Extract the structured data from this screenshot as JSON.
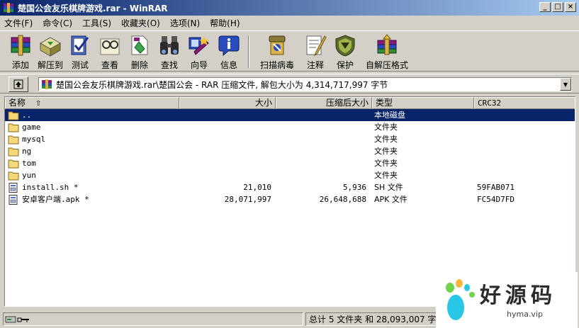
{
  "window": {
    "title": "楚国公会友乐棋牌游戏.rar - WinRAR",
    "controls": [
      "_",
      "□",
      "×"
    ]
  },
  "menu": [
    "文件(F)",
    "命令(C)",
    "工具(S)",
    "收藏夹(O)",
    "选项(N)",
    "帮助(H)"
  ],
  "toolbar": [
    {
      "label": "添加",
      "icon": "add-archive-icon"
    },
    {
      "label": "解压到",
      "icon": "extract-to-icon"
    },
    {
      "label": "测试",
      "icon": "test-icon"
    },
    {
      "label": "查看",
      "icon": "view-icon"
    },
    {
      "label": "删除",
      "icon": "delete-icon"
    },
    {
      "label": "查找",
      "icon": "find-icon"
    },
    {
      "label": "向导",
      "icon": "wizard-icon"
    },
    {
      "label": "信息",
      "icon": "info-icon"
    },
    {
      "label": "扫描病毒",
      "icon": "virus-scan-icon"
    },
    {
      "label": "注释",
      "icon": "comment-icon"
    },
    {
      "label": "保护",
      "icon": "protect-icon"
    },
    {
      "label": "自解压格式",
      "icon": "sfx-icon"
    }
  ],
  "address": {
    "path": "楚国公会友乐棋牌游戏.rar\\楚国公会 - RAR 压缩文件, 解包大小为 4,314,717,997 字节"
  },
  "columns": {
    "name": "名称",
    "size": "大小",
    "packed": "压缩后大小",
    "type": "类型",
    "crc": "CRC32"
  },
  "files": [
    {
      "name": "..",
      "size": "",
      "packed": "",
      "type": "本地磁盘",
      "crc": "",
      "kind": "folder-up",
      "selected": true
    },
    {
      "name": "game",
      "size": "",
      "packed": "",
      "type": "文件夹",
      "crc": "",
      "kind": "folder"
    },
    {
      "name": "mysql",
      "size": "",
      "packed": "",
      "type": "文件夹",
      "crc": "",
      "kind": "folder"
    },
    {
      "name": "ng",
      "size": "",
      "packed": "",
      "type": "文件夹",
      "crc": "",
      "kind": "folder"
    },
    {
      "name": "tom",
      "size": "",
      "packed": "",
      "type": "文件夹",
      "crc": "",
      "kind": "folder"
    },
    {
      "name": "yun",
      "size": "",
      "packed": "",
      "type": "文件夹",
      "crc": "",
      "kind": "folder"
    },
    {
      "name": "install.sh *",
      "size": "21,010",
      "packed": "5,936",
      "type": "SH 文件",
      "crc": "59FAB071",
      "kind": "file"
    },
    {
      "name": "安卓客户端.apk *",
      "size": "28,071,997",
      "packed": "26,648,688",
      "type": "APK 文件",
      "crc": "FC54D7FD",
      "kind": "file"
    }
  ],
  "status": {
    "right": "总计 5 文件夹 和 28,093,007 字节"
  },
  "watermark": {
    "text": "好源码",
    "url": "hyma.vip"
  },
  "colors": {
    "title_start": "#0a246a",
    "title_end": "#a6caf0",
    "selection": "#0a246a",
    "folder": "#f5d87a",
    "watermark_logo": "#28c7e6"
  }
}
